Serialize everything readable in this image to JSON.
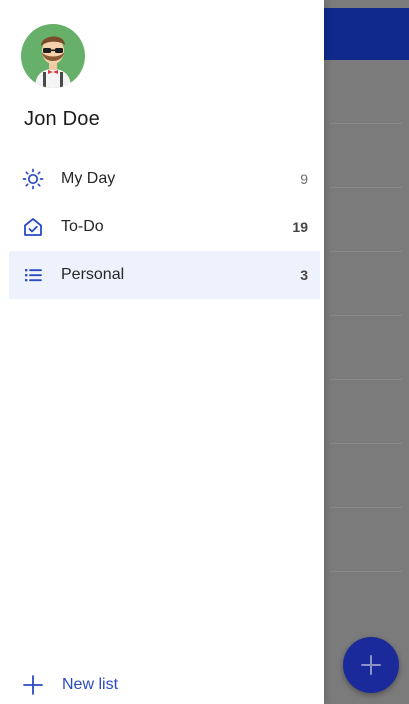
{
  "user": {
    "name": "Jon Doe",
    "avatar_icon": "person-with-sunglasses-avatar-icon"
  },
  "nav": {
    "items": [
      {
        "label": "My Day",
        "count": "9",
        "icon": "sun-icon"
      },
      {
        "label": "To-Do",
        "count": "19",
        "icon": "home-check-icon"
      },
      {
        "label": "Personal",
        "count": "3",
        "icon": "list-icon"
      }
    ],
    "active_index": 2
  },
  "footer": {
    "new_list_label": "New list",
    "icon": "plus-icon"
  },
  "colors": {
    "accent": "#2b4ac2",
    "app_bar": "#0f2a8c",
    "active_bg": "#eef2fd",
    "avatar_bg": "#67b06a",
    "fab": "#1a2a9a"
  }
}
